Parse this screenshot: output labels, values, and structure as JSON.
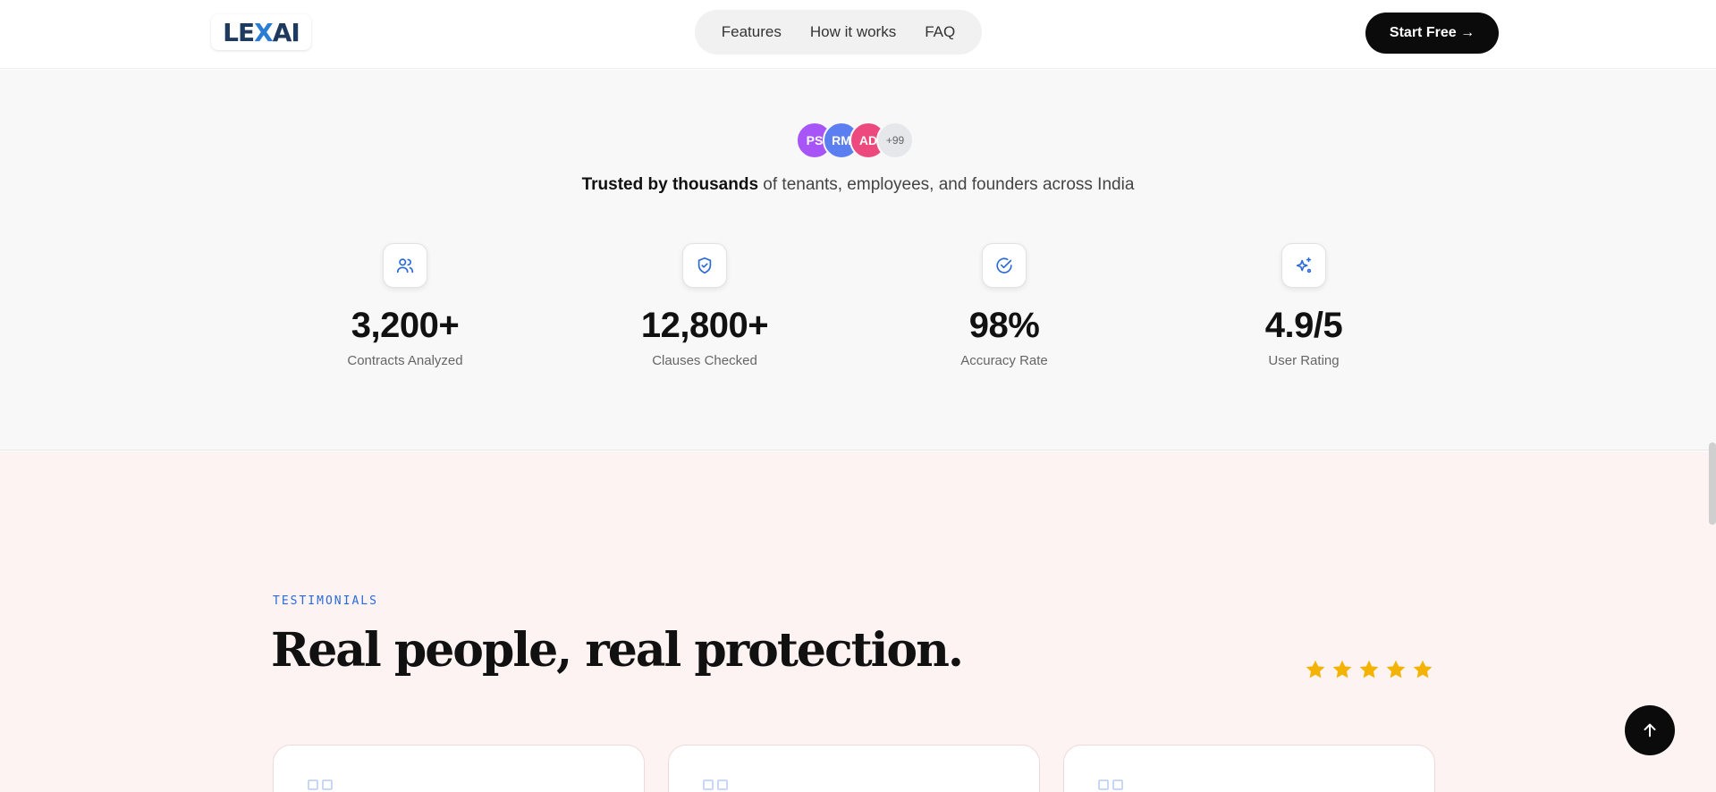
{
  "header": {
    "logo_text": "LEXAI",
    "nav": [
      "Features",
      "How it works",
      "FAQ"
    ],
    "cta_label": "Start Free →"
  },
  "social_proof": {
    "avatars": [
      {
        "initials": "PS",
        "color": "#a855f7"
      },
      {
        "initials": "RM",
        "color": "#5b7ff0"
      },
      {
        "initials": "AD",
        "color": "#ec4a7f"
      }
    ],
    "more_count": "+99",
    "trusted_bold": "Trusted by thousands",
    "trusted_rest": " of tenants, employees, and founders across India"
  },
  "stats": [
    {
      "icon": "users-icon",
      "value": "3,200+",
      "label": "Contracts Analyzed"
    },
    {
      "icon": "shield-check-icon",
      "value": "12,800+",
      "label": "Clauses Checked"
    },
    {
      "icon": "check-circle-icon",
      "value": "98%",
      "label": "Accuracy Rate"
    },
    {
      "icon": "sparkles-icon",
      "value": "4.9/5",
      "label": "User Rating"
    }
  ],
  "testimonials": {
    "eyebrow": "TESTIMONIALS",
    "headline": "Real people, real protection.",
    "rating_stars": 5
  },
  "colors": {
    "accent": "#2b6ad6",
    "star": "#f5b301",
    "stats_bg": "#f8f8f8",
    "testimonials_bg": "#fdf3f3"
  }
}
